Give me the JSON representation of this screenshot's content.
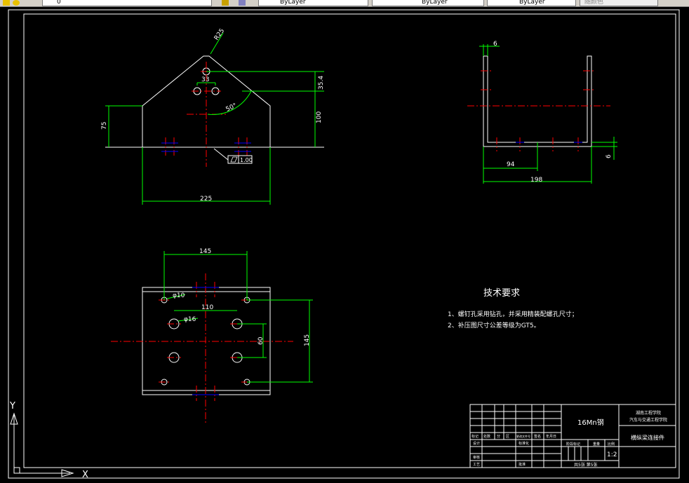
{
  "toolbar": {
    "layer_value": "0",
    "color_value": "ByLayer",
    "linetype_value": "ByLayer",
    "lineweight_value": "ByLayer",
    "plotstyle_value": "随颜色"
  },
  "colors": {
    "background": "#000000",
    "outline": "#ffffff",
    "dimension": "#00ff00",
    "centerline": "#ff0000",
    "hidden": "#0000ff"
  },
  "front_view": {
    "dim_r": "R25",
    "dim_33": "33",
    "dim_35_4": "35.4",
    "dim_50deg": "50°",
    "dim_100": "100",
    "dim_75": "75",
    "dim_225": "225",
    "flatness": "1.00"
  },
  "side_view": {
    "dim_6_top": "6",
    "dim_94": "94",
    "dim_198": "198",
    "dim_6_right": "6"
  },
  "plan_view": {
    "dim_145_top": "145",
    "dim_phi10": "φ10",
    "dim_110": "110",
    "dim_phi16": "φ16",
    "dim_60": "60",
    "dim_145_right": "145"
  },
  "notes": {
    "title": "技术要求",
    "line1": "1、螺钉孔采用钻孔，并采用精装配螺孔尺寸；",
    "line2": "2、补压图尺寸公差等级为GT5。"
  },
  "title_block": {
    "material": "16Mn钢",
    "school_line1": "湖南工程学院",
    "school_line2": "汽车与交通工程学院",
    "part_name": "横纵梁连接件",
    "scale": "1:2",
    "sheets": "共5张  第5张",
    "row_labels": [
      "标记",
      "处数",
      "分",
      "区",
      "更改文件号",
      "签名",
      "年月日"
    ],
    "design": "设计",
    "standard": "标准化",
    "review": "审核",
    "process": "工艺",
    "approve": "批准",
    "stage": "阶段标记",
    "weight": "重量",
    "ratio": "比例"
  },
  "ucs": {
    "y_label": "Y",
    "x_label": "X"
  }
}
